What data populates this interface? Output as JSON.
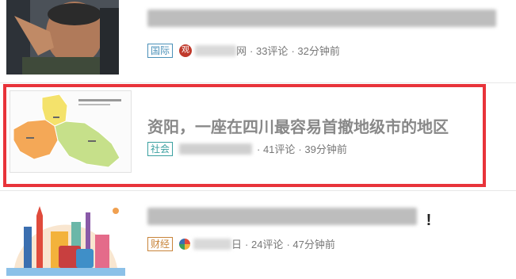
{
  "feed": {
    "items": [
      {
        "title": "",
        "tag": "国际",
        "tag_color": "#4a90b8",
        "source_icon": "观",
        "source_suffix": "网",
        "comments": "· 33评论",
        "time": "· 32分钟前"
      },
      {
        "title": "资阳，一座在四川最容易首撤地级市的地区",
        "tag": "社会",
        "tag_color": "#3aa0a0",
        "source_suffix": "",
        "comments": "· 41评论",
        "time": "· 39分钟前"
      },
      {
        "title": "",
        "title_end": "!",
        "tag": "财经",
        "tag_color": "#c8843a",
        "source_suffix": "日",
        "comments": "· 24评论",
        "time": "· 47分钟前"
      }
    ]
  },
  "colors": {
    "highlight": "#e8333a",
    "map_orange": "#f4a857",
    "map_yellow": "#f4e26b",
    "map_green": "#c6e08a"
  }
}
